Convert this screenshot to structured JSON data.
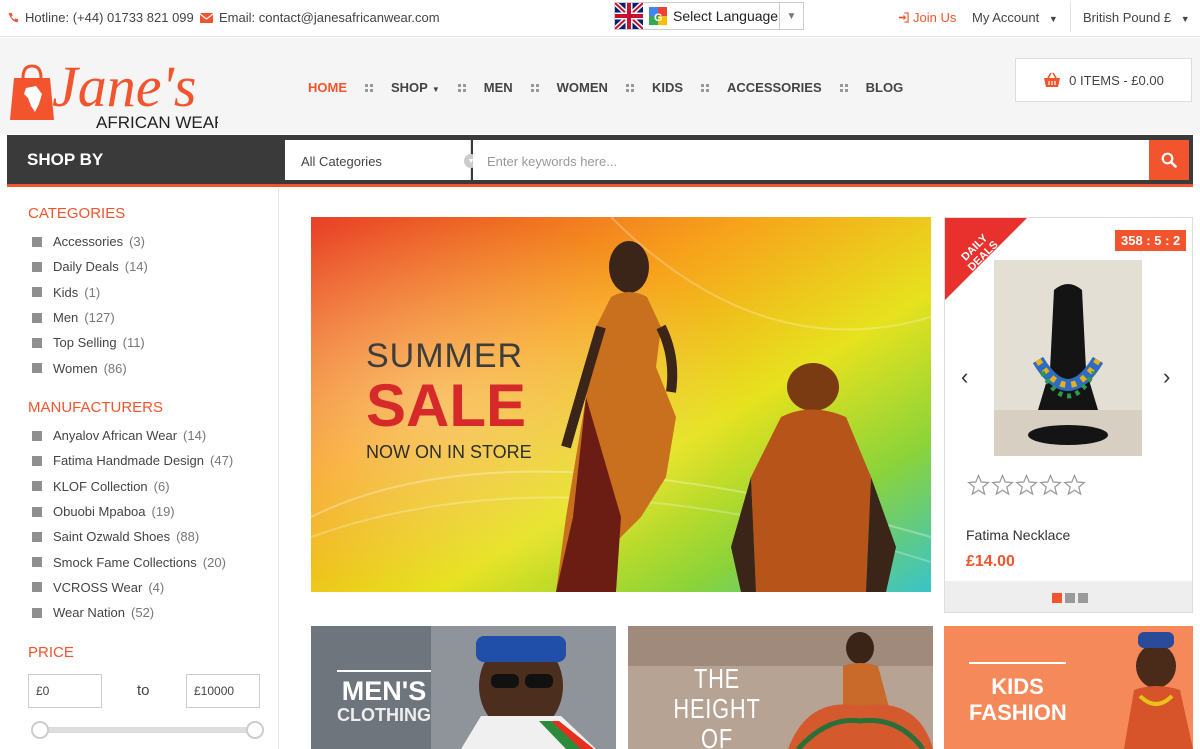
{
  "topbar": {
    "hotline": "Hotline: (+44) 01733 821 099",
    "email": "Email: contact@janesafricanwear.com",
    "language": "Select Language",
    "join": "Join Us",
    "account": "My Account",
    "currency": "British Pound £"
  },
  "logo": {
    "word1": "Jane's",
    "word2": "AFRICAN WEAR"
  },
  "nav": [
    "HOME",
    "SHOP",
    "MEN",
    "WOMEN",
    "KIDS",
    "ACCESSORIES",
    "BLOG"
  ],
  "cart": {
    "label": "0 ITEMS - £0.00"
  },
  "search": {
    "shop_by": "SHOP BY",
    "category": "All Categories",
    "placeholder": "Enter keywords here..."
  },
  "sidebar": {
    "categories_title": "CATEGORIES",
    "categories": [
      {
        "name": "Accessories",
        "count": "(3)"
      },
      {
        "name": "Daily Deals",
        "count": "(14)"
      },
      {
        "name": "Kids",
        "count": "(1)"
      },
      {
        "name": "Men",
        "count": "(127)"
      },
      {
        "name": "Top Selling",
        "count": "(11)"
      },
      {
        "name": "Women",
        "count": "(86)"
      }
    ],
    "manufacturers_title": "MANUFACTURERS",
    "manufacturers": [
      {
        "name": "Anyalov African Wear",
        "count": "(14)"
      },
      {
        "name": "Fatima Handmade Design",
        "count": "(47)"
      },
      {
        "name": "KLOF Collection",
        "count": "(6)"
      },
      {
        "name": "Obuobi Mpaboa",
        "count": "(19)"
      },
      {
        "name": "Saint Ozwald Shoes",
        "count": "(88)"
      },
      {
        "name": "Smock Fame Collections",
        "count": "(20)"
      },
      {
        "name": "VCROSS Wear",
        "count": "(4)"
      },
      {
        "name": "Wear Nation",
        "count": "(52)"
      }
    ],
    "price_title": "PRICE",
    "price_min": "£0",
    "price_to": "to",
    "price_max": "£10000"
  },
  "banner": {
    "line1": "SUMMER",
    "line2": "SALE",
    "line3": "NOW ON IN STORE"
  },
  "deal": {
    "ribbon1": "DAILY",
    "ribbon2": "DEALS",
    "timer": "358 : 5 : 2",
    "name": "Fatima Necklace",
    "price": "£14.00",
    "rating": 0
  },
  "tiles": [
    {
      "line1": "MEN'S",
      "line2": "CLOTHING"
    },
    {
      "line1": "THE HEIGHT",
      "line2": "OF FASHION"
    },
    {
      "line1": "KIDS",
      "line2": "FASHION"
    }
  ],
  "colors": {
    "accent": "#f2542d",
    "dark": "#3a3a3a"
  }
}
